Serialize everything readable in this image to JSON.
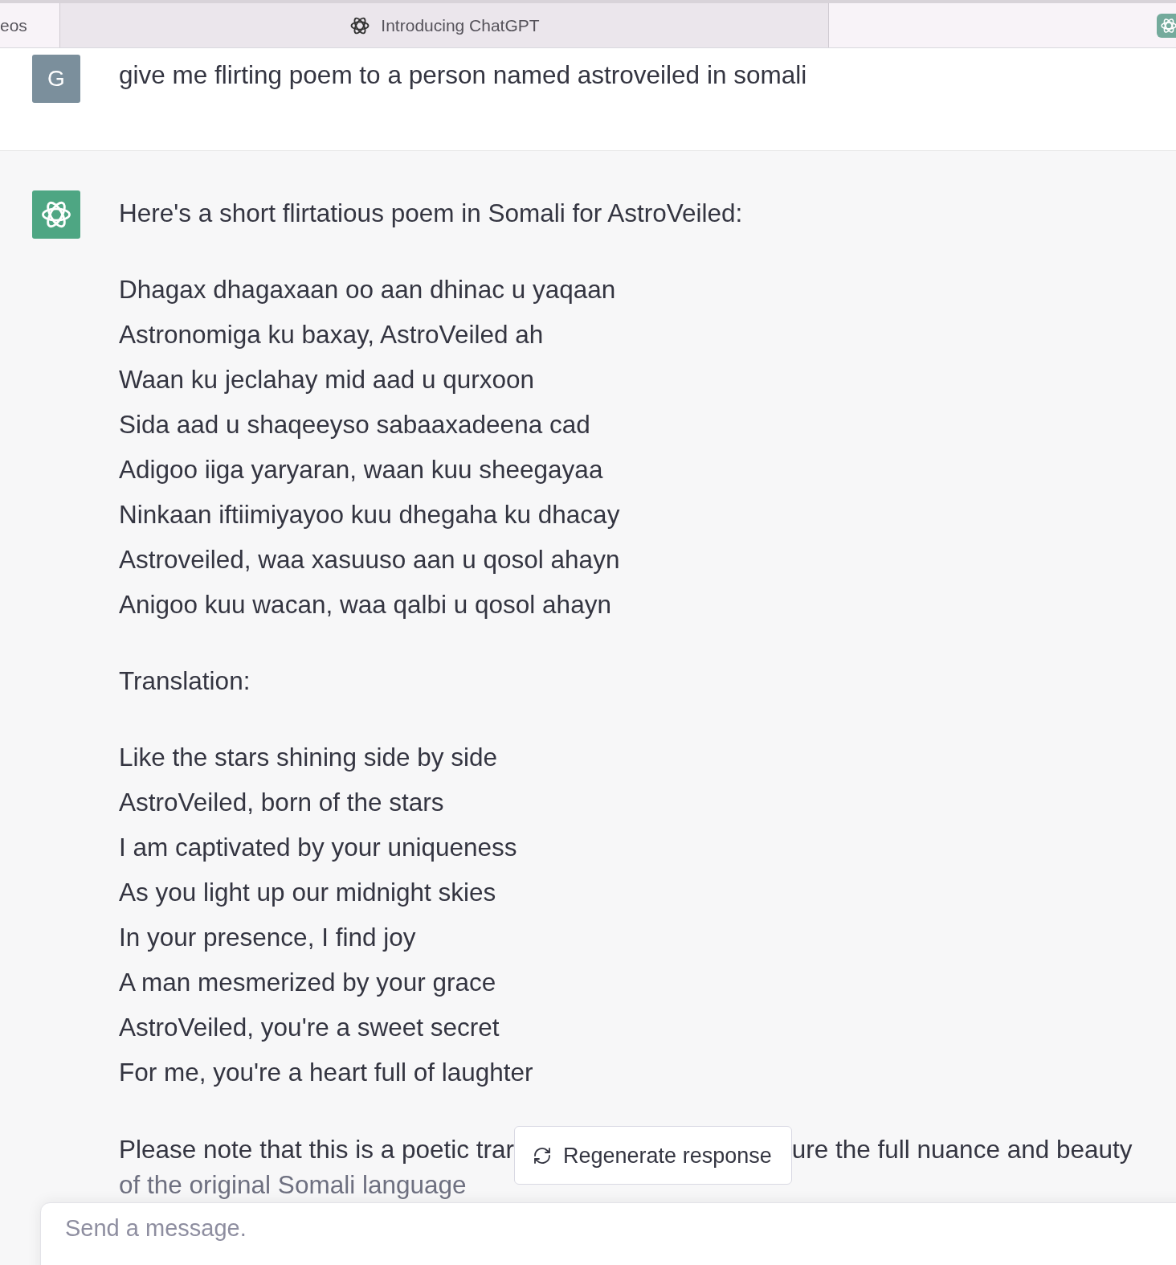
{
  "browser_tabs": [
    {
      "title": "eos",
      "selected": false
    },
    {
      "title": "Introducing ChatGPT",
      "selected": true
    }
  ],
  "messages": [
    {
      "kind": "user",
      "avatar": "G",
      "text": "give me flirting poem to a person named astroveiled in somali"
    },
    {
      "kind": "assistant",
      "intro": "Here's a short flirtatious poem in Somali for AstroVeiled:",
      "poem": [
        "Dhagax dhagaxaan oo aan dhinac u yaqaan",
        "Astronomiga ku baxay, AstroVeiled ah",
        "Waan ku jeclahay mid aad u qurxoon",
        "Sida aad u shaqeeyso sabaaxadeena cad",
        "Adigoo iiga yaryaran, waan kuu sheegayaa",
        "Ninkaan iftiimiyayoo kuu dhegaha ku dhacay",
        "Astroveiled, waa xasuuso aan u qosol ahayn",
        "Anigoo kuu wacan, waa qalbi u qosol ahayn"
      ],
      "translation_heading": "Translation:",
      "translation": [
        "Like the stars shining side by side",
        "AstroVeiled, born of the stars",
        "I am captivated by your uniqueness",
        "As you light up our midnight skies",
        "In your presence, I find joy",
        "A man mesmerized by your grace",
        "AstroVeiled, you're a sweet secret",
        "For me, you're a heart full of laughter"
      ],
      "note_before": "Please note that this is a poetic trar",
      "note_after": "ure the full nuance and beauty",
      "note_faded": "of the original Somali language"
    }
  ],
  "regenerate_button": {
    "label": "Regenerate response"
  },
  "composer": {
    "placeholder": "Send a message."
  }
}
